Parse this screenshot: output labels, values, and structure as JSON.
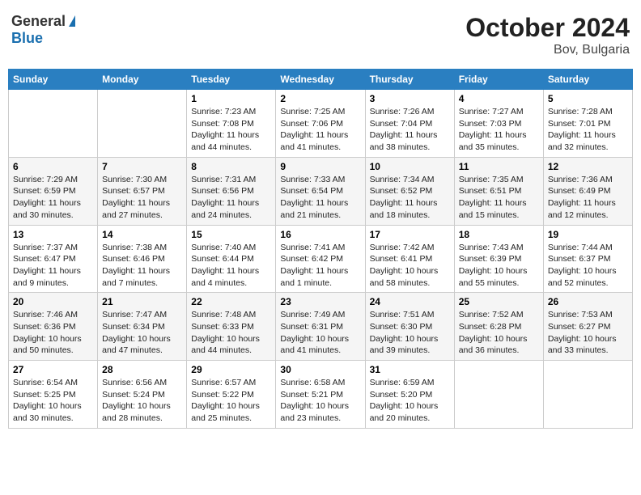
{
  "header": {
    "logo_general": "General",
    "logo_blue": "Blue",
    "month": "October 2024",
    "location": "Bov, Bulgaria"
  },
  "weekdays": [
    "Sunday",
    "Monday",
    "Tuesday",
    "Wednesday",
    "Thursday",
    "Friday",
    "Saturday"
  ],
  "weeks": [
    [
      {
        "day": "",
        "info": ""
      },
      {
        "day": "",
        "info": ""
      },
      {
        "day": "1",
        "info": "Sunrise: 7:23 AM\nSunset: 7:08 PM\nDaylight: 11 hours and 44 minutes."
      },
      {
        "day": "2",
        "info": "Sunrise: 7:25 AM\nSunset: 7:06 PM\nDaylight: 11 hours and 41 minutes."
      },
      {
        "day": "3",
        "info": "Sunrise: 7:26 AM\nSunset: 7:04 PM\nDaylight: 11 hours and 38 minutes."
      },
      {
        "day": "4",
        "info": "Sunrise: 7:27 AM\nSunset: 7:03 PM\nDaylight: 11 hours and 35 minutes."
      },
      {
        "day": "5",
        "info": "Sunrise: 7:28 AM\nSunset: 7:01 PM\nDaylight: 11 hours and 32 minutes."
      }
    ],
    [
      {
        "day": "6",
        "info": "Sunrise: 7:29 AM\nSunset: 6:59 PM\nDaylight: 11 hours and 30 minutes."
      },
      {
        "day": "7",
        "info": "Sunrise: 7:30 AM\nSunset: 6:57 PM\nDaylight: 11 hours and 27 minutes."
      },
      {
        "day": "8",
        "info": "Sunrise: 7:31 AM\nSunset: 6:56 PM\nDaylight: 11 hours and 24 minutes."
      },
      {
        "day": "9",
        "info": "Sunrise: 7:33 AM\nSunset: 6:54 PM\nDaylight: 11 hours and 21 minutes."
      },
      {
        "day": "10",
        "info": "Sunrise: 7:34 AM\nSunset: 6:52 PM\nDaylight: 11 hours and 18 minutes."
      },
      {
        "day": "11",
        "info": "Sunrise: 7:35 AM\nSunset: 6:51 PM\nDaylight: 11 hours and 15 minutes."
      },
      {
        "day": "12",
        "info": "Sunrise: 7:36 AM\nSunset: 6:49 PM\nDaylight: 11 hours and 12 minutes."
      }
    ],
    [
      {
        "day": "13",
        "info": "Sunrise: 7:37 AM\nSunset: 6:47 PM\nDaylight: 11 hours and 9 minutes."
      },
      {
        "day": "14",
        "info": "Sunrise: 7:38 AM\nSunset: 6:46 PM\nDaylight: 11 hours and 7 minutes."
      },
      {
        "day": "15",
        "info": "Sunrise: 7:40 AM\nSunset: 6:44 PM\nDaylight: 11 hours and 4 minutes."
      },
      {
        "day": "16",
        "info": "Sunrise: 7:41 AM\nSunset: 6:42 PM\nDaylight: 11 hours and 1 minute."
      },
      {
        "day": "17",
        "info": "Sunrise: 7:42 AM\nSunset: 6:41 PM\nDaylight: 10 hours and 58 minutes."
      },
      {
        "day": "18",
        "info": "Sunrise: 7:43 AM\nSunset: 6:39 PM\nDaylight: 10 hours and 55 minutes."
      },
      {
        "day": "19",
        "info": "Sunrise: 7:44 AM\nSunset: 6:37 PM\nDaylight: 10 hours and 52 minutes."
      }
    ],
    [
      {
        "day": "20",
        "info": "Sunrise: 7:46 AM\nSunset: 6:36 PM\nDaylight: 10 hours and 50 minutes."
      },
      {
        "day": "21",
        "info": "Sunrise: 7:47 AM\nSunset: 6:34 PM\nDaylight: 10 hours and 47 minutes."
      },
      {
        "day": "22",
        "info": "Sunrise: 7:48 AM\nSunset: 6:33 PM\nDaylight: 10 hours and 44 minutes."
      },
      {
        "day": "23",
        "info": "Sunrise: 7:49 AM\nSunset: 6:31 PM\nDaylight: 10 hours and 41 minutes."
      },
      {
        "day": "24",
        "info": "Sunrise: 7:51 AM\nSunset: 6:30 PM\nDaylight: 10 hours and 39 minutes."
      },
      {
        "day": "25",
        "info": "Sunrise: 7:52 AM\nSunset: 6:28 PM\nDaylight: 10 hours and 36 minutes."
      },
      {
        "day": "26",
        "info": "Sunrise: 7:53 AM\nSunset: 6:27 PM\nDaylight: 10 hours and 33 minutes."
      }
    ],
    [
      {
        "day": "27",
        "info": "Sunrise: 6:54 AM\nSunset: 5:25 PM\nDaylight: 10 hours and 30 minutes."
      },
      {
        "day": "28",
        "info": "Sunrise: 6:56 AM\nSunset: 5:24 PM\nDaylight: 10 hours and 28 minutes."
      },
      {
        "day": "29",
        "info": "Sunrise: 6:57 AM\nSunset: 5:22 PM\nDaylight: 10 hours and 25 minutes."
      },
      {
        "day": "30",
        "info": "Sunrise: 6:58 AM\nSunset: 5:21 PM\nDaylight: 10 hours and 23 minutes."
      },
      {
        "day": "31",
        "info": "Sunrise: 6:59 AM\nSunset: 5:20 PM\nDaylight: 10 hours and 20 minutes."
      },
      {
        "day": "",
        "info": ""
      },
      {
        "day": "",
        "info": ""
      }
    ]
  ]
}
